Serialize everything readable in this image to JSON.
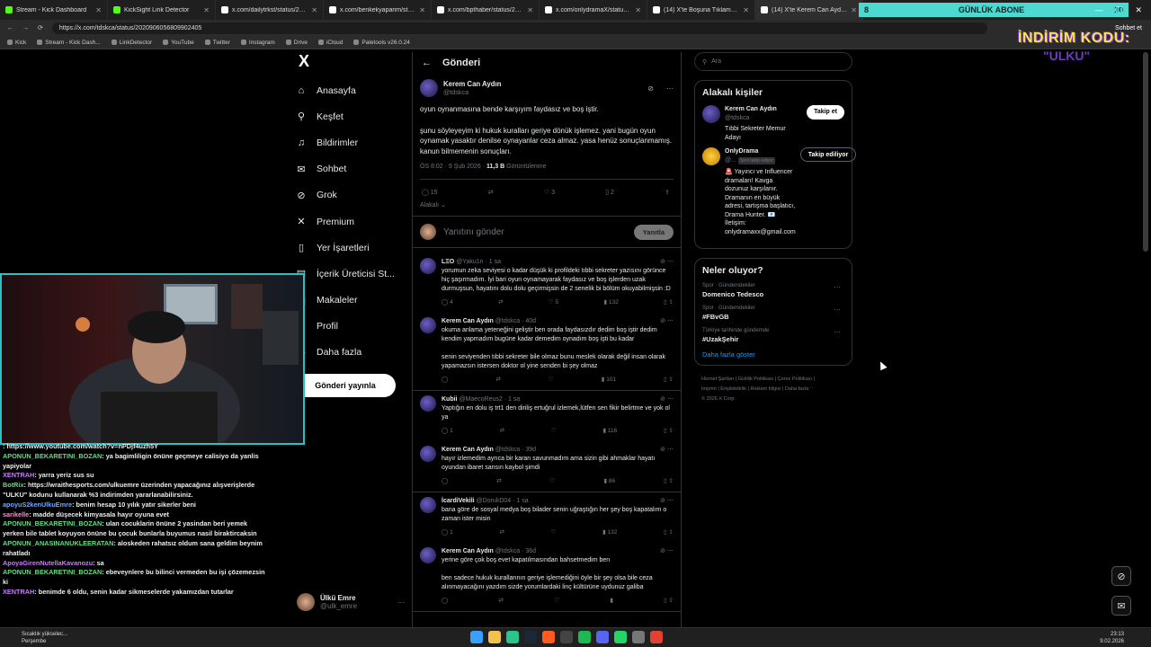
{
  "browser": {
    "tabs": [
      {
        "title": "Stream - Kick Dashboard",
        "color": "#53fc18"
      },
      {
        "title": "KickSight Link Detector",
        "color": "#53fc18"
      },
      {
        "title": "x.com/dailytrkst/status/20199316...",
        "color": "#ffffff"
      },
      {
        "title": "x.com/benkekyaparim/status/2019...",
        "color": "#ffffff"
      },
      {
        "title": "x.com/bpthaber/status/20209434...",
        "color": "#ffffff"
      },
      {
        "title": "x.com/onlydramaX/status/202091...",
        "color": "#ffffff"
      },
      {
        "title": "(14) X'te Boşuna Tıklama: \"2025'te...",
        "color": "#ffffff"
      },
      {
        "title": "(14) X'te Kerem Can Aydın: \"@onl...",
        "color": "#ffffff"
      }
    ],
    "url": "https://x.com/tdskca/status/2020906056809902405",
    "bookmarks": [
      "Kick",
      "Stream - Kick Dash...",
      "LinkDetector",
      "YouTube",
      "Twitter",
      "Instagram",
      "Drive",
      "iCloud",
      "Paletools v26.0.24"
    ],
    "sohbet_label": "Sohbet et"
  },
  "overlay": {
    "sub_count": "8",
    "sub_label": "GÜNLÜK ABONE",
    "sub_goal": "10",
    "promo_title": "İNDİRİM KODU:",
    "promo_code": "\"ULKU\""
  },
  "nav": {
    "logo": "X",
    "items": [
      {
        "label": "Anasayfa",
        "icon": "home-icon",
        "glyph": "⌂"
      },
      {
        "label": "Keşfet",
        "icon": "search-icon",
        "glyph": "⚲"
      },
      {
        "label": "Bildirimler",
        "icon": "bell-icon",
        "glyph": "♫"
      },
      {
        "label": "Sohbet",
        "icon": "chat-icon",
        "glyph": "✉"
      },
      {
        "label": "Grok",
        "icon": "grok-icon",
        "glyph": "⊘"
      },
      {
        "label": "Premium",
        "icon": "x-premium-icon",
        "glyph": "✕"
      },
      {
        "label": "Yer İşaretleri",
        "icon": "bookmark-icon",
        "glyph": "▯"
      },
      {
        "label": "İçerik Üreticisi St...",
        "icon": "creator-icon",
        "glyph": "▤"
      },
      {
        "label": "Makaleler",
        "icon": "article-icon",
        "glyph": "▥"
      },
      {
        "label": "Profil",
        "icon": "profile-icon",
        "glyph": "☺"
      },
      {
        "label": "Daha fazla",
        "icon": "more-icon",
        "glyph": "⋯"
      }
    ],
    "post_button": "Gönderi yayınla",
    "profile_name": "Ülkü Emre",
    "profile_handle": "@ulk_emre"
  },
  "post": {
    "header": "Gönderi",
    "author": "Kerem Can Aydın",
    "handle": "@tdskca",
    "text1": "oyun oynanmasına bende karşıyım faydasız ve boş iştir.",
    "text2": " şunu söyleyeyim ki hukuk kuralları geriye dönük işlemez. yani bugün oyun oynamak yasaktır denilse oynayanlar ceza almaz. yasa henüz sonuçlanmamış. kanun bilmemenin sonuçları.",
    "time": "ÖS 8:02 · 9 Şub 2026 · ",
    "views": "11,3 B",
    "views_label": " Görüntülenme",
    "replies": "15",
    "likes": "3",
    "bookmarks": "2",
    "related": "Alakalı ⌄",
    "reply_placeholder": "Yanıtını gönder",
    "reply_button": "Yanıtla"
  },
  "comments": [
    {
      "name": "LΞO",
      "handle": "@Yaku1n · 1 sa",
      "text": "yorumun zeka seviyesi o kadar düşük ki profildeki tıbbi sekreter yazısını görünce hiç şaşırmadım. İyi bari oyun oynamayarak faydasız ve boş işlerden uzak durmuşsun, hayatını dolu dolu geçirmişsin de 2 senelik bi bölüm okuyabilmişsin :D",
      "r": "4",
      "l": "5",
      "v": "132"
    },
    {
      "name": "Kerem Can Aydın",
      "handle": "@tdskca · 40d",
      "text": "okuma anlama yeteneğini geliştir ben orada faydasızdır dedim boş iştir dedim kendim yapmadım bugüne kadar demedim oynadım boş işti bu kadar\n\nsenin seviyenden tıbbi sekreter bile olmaz bunu meslek olarak değil insan olarak yapamazsın istersen doktor ol yine senden bi şey olmaz",
      "r": "",
      "l": "",
      "v": "101"
    },
    {
      "name": "Kubii",
      "handle": "@MaecoReus2 · 1 sa",
      "text": "Yaptığın en dolu iş trt1 den diriliş ertuğrul izlemek,lütfen sen fikir belirtme ve yok ol ya",
      "r": "1",
      "l": "",
      "v": "116"
    },
    {
      "name": "Kerem Can Aydın",
      "handle": "@tdskca · 39d",
      "text": "hayır izlemedim ayrıca bir karan savunmadım ama sizin gibi ahmaklar hayatı oyundan ibaret sansın kaybol şimdi",
      "r": "",
      "l": "",
      "v": "86"
    },
    {
      "name": "İcardiVekili",
      "handle": "@DorukD04 · 1 sa",
      "text": "bana göre de sosyal medya boş bilader senin uğraştığın her şey boş kapatalım o zaman ister misin",
      "r": "1",
      "l": "",
      "v": "132"
    },
    {
      "name": "Kerem Can Aydın",
      "handle": "@tdskca · 36d",
      "text": "yerine göre çok boş evet kapatılmasından bahsetmedim ben\n\nben sadece hukuk kurallarının geriye işlemediğini öyle bir şey olsa bile ceza alınmayacağını yazdım sizde yorumlardaki linç kültürüne uydunuz galiba",
      "r": "",
      "l": "",
      "v": ""
    }
  ],
  "right": {
    "search_placeholder": "Ara",
    "related_title": "Alakalı kişiler",
    "people": [
      {
        "name": "Kerem Can Aydın",
        "handle": "@tdskca",
        "bio": "Tıbbi Sekreter Memur Adayı",
        "button": "Takip et"
      },
      {
        "name": "OnlyDrama",
        "handle": "@...",
        "badge": "Seni takip ediyor",
        "bio": "🚨 Yayıncı ve Influencer dramaları! Kavga dozunuz karşılanır. Dramanın en büyük adresi, tartışma başlatıcı, Drama Hunter. 📧 İletişim: onlydramaxx@gmail.com",
        "button": "Takip ediliyor"
      }
    ],
    "trends_title": "Neler oluyor?",
    "trends": [
      {
        "context": "Spor · Gündemdekiler",
        "name": "Domenico Tedesco"
      },
      {
        "context": "Spor · Gündemdekiler",
        "name": "#FBvGB"
      },
      {
        "context": "Türkiye tarihinde gündemde",
        "name": "#UzakŞehir"
      }
    ],
    "show_more": "Daha fazla göster",
    "footer1": "Hizmet Şartları  |  Gizlilik Politikası  |  Çerez Politikası  |",
    "footer2": "Imprint  |  Erişilebilirlik  |  Reklam bilgisi  |  Daha fazla ⋯",
    "footer3": "© 2026 X Corp."
  },
  "chat": [
    {
      "user": "",
      "msg": ": https://www.youtube.com/watch?v=nPDjf4uzh5Y",
      "cls": "u2"
    },
    {
      "user": "APONUN_BEKARETINI_BOZAN",
      "msg": ": ya bagimliligin önüne geçmeye calisiyo da yanlis yapiyolar",
      "cls": "u1"
    },
    {
      "user": "XENTRAH",
      "msg": ": yarra yeriz sus su",
      "cls": "u2"
    },
    {
      "user": "BotRix",
      "msg": ": https://wraithesports.com/ulkuemre üzerinden yapacağınız alışverişlerde \"ULKU\" kodunu kullanarak %3 indirimden yararlanabilirsiniz.",
      "cls": "u1"
    },
    {
      "user": "apoyuS2kenUlkuEmre",
      "msg": ": benim hesap 10 yılık yatır sikerler beni",
      "cls": "u3"
    },
    {
      "user": "sarikelle",
      "msg": ": madde düşecek kimyasala hayır oyuna evet",
      "cls": "u4"
    },
    {
      "user": "APONUN_BEKARETINI_BOZAN",
      "msg": ": ulan cocuklarin önüne 2 yasindan beri yemek yerken bile tablet koyuyon önüne bu çocuk bunlarla buyumus nasil biraktircaksin",
      "cls": "u1"
    },
    {
      "user": "APONUN_ANASINANUKLEERATAN",
      "msg": ": aloskeden rahatsız oldum sana geldim beynim rahatladı",
      "cls": "u1"
    },
    {
      "user": "ApoyaGirenNutellaKavanozu",
      "msg": ": sa",
      "cls": "u2"
    },
    {
      "user": "APONUN_BEKARETINI_BOZAN",
      "msg": ": ebeveynlere bu bilinci vermeden bu işi çözemezsin ki",
      "cls": "u1"
    },
    {
      "user": "XENTRAH",
      "msg": ": benimde 6 oldu, senin kadar sikmeselerde yakamızdan tutarlar",
      "cls": "u2"
    }
  ],
  "taskbar": {
    "weather": "Sıcaklık yükselec...",
    "weather2": "Perşembe",
    "time": "23:13",
    "date": "9.02.2026"
  }
}
